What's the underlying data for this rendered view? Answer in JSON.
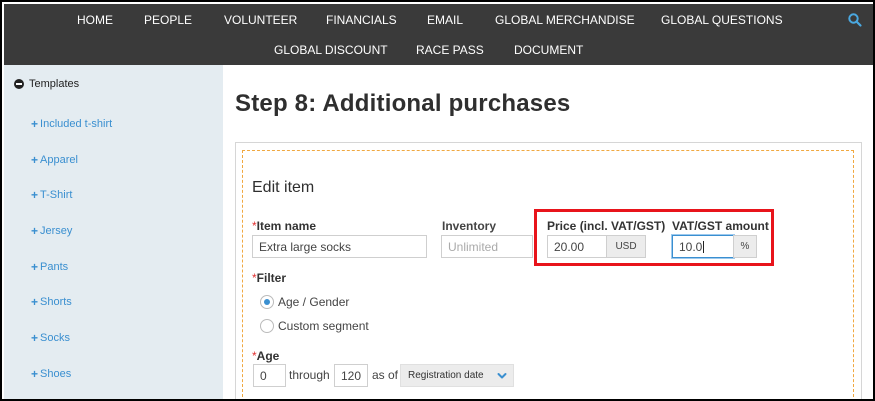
{
  "nav": {
    "row1": [
      "HOME",
      "PEOPLE",
      "VOLUNTEER",
      "FINANCIALS",
      "EMAIL",
      "GLOBAL MERCHANDISE",
      "GLOBAL QUESTIONS"
    ],
    "row2": [
      "GLOBAL DISCOUNT",
      "RACE PASS",
      "DOCUMENT"
    ],
    "search_icon": "search-icon"
  },
  "sidebar": {
    "header": "Templates",
    "items": [
      "Included t-shirt",
      "Apparel",
      "T-Shirt",
      "Jersey",
      "Pants",
      "Shorts",
      "Socks",
      "Shoes"
    ]
  },
  "main": {
    "title": "Step 8: Additional purchases",
    "edit_heading": "Edit item",
    "item_name": {
      "label": "Item name",
      "required_mark": "*",
      "value": "Extra large socks"
    },
    "inventory": {
      "label": "Inventory",
      "placeholder": "Unlimited"
    },
    "price": {
      "label": "Price (incl. VAT/GST)",
      "value": "20.00",
      "currency": "USD"
    },
    "vat": {
      "label": "VAT/GST amount",
      "value": "10.0",
      "unit": "%"
    },
    "filter": {
      "label": "Filter",
      "required_mark": "*",
      "options": [
        {
          "label": "Age / Gender",
          "checked": true
        },
        {
          "label": "Custom segment",
          "checked": false
        }
      ]
    },
    "age": {
      "label": "Age",
      "required_mark": "*",
      "from": "0",
      "through_text": "through",
      "to": "120",
      "as_of_text": "as of",
      "as_of_value": "Registration date"
    }
  },
  "colors": {
    "nav_bg": "#3a3a3a",
    "sidebar_bg": "#e4ecf1",
    "link": "#3a8fd0",
    "highlight": "#e8141b",
    "dashed": "#f0a840"
  }
}
